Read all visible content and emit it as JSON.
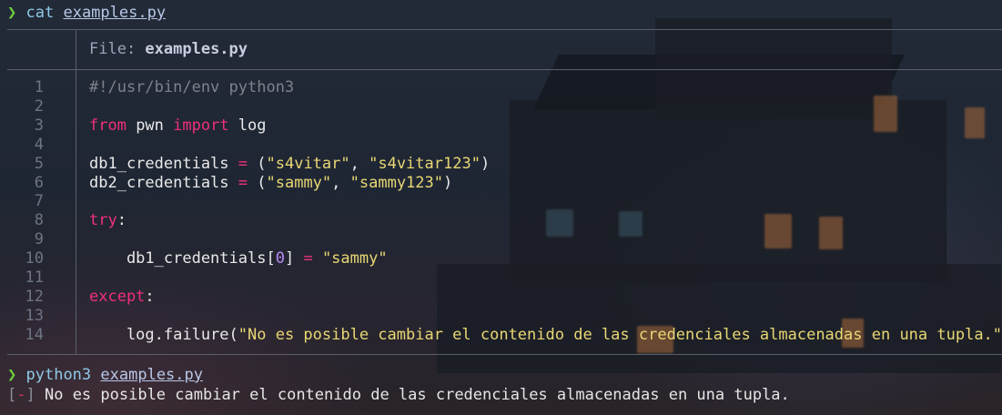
{
  "terminal": {
    "prompt_symbol": "❯",
    "first_command": {
      "cmd": "cat",
      "arg": "examples.py"
    },
    "bat": {
      "file_prefix": "File: ",
      "file_name": "examples.py",
      "lines": [
        {
          "n": "1",
          "tokens": [
            {
              "t": "#!/usr/bin/env python3",
              "c": "cmt"
            }
          ]
        },
        {
          "n": "2",
          "tokens": []
        },
        {
          "n": "3",
          "tokens": [
            {
              "t": "from",
              "c": "kw"
            },
            {
              "t": " pwn ",
              "c": ""
            },
            {
              "t": "import",
              "c": "kw"
            },
            {
              "t": " log",
              "c": ""
            }
          ]
        },
        {
          "n": "4",
          "tokens": []
        },
        {
          "n": "5",
          "tokens": [
            {
              "t": "db1_credentials ",
              "c": ""
            },
            {
              "t": "=",
              "c": "op"
            },
            {
              "t": " (",
              "c": ""
            },
            {
              "t": "\"s4vitar\"",
              "c": "str"
            },
            {
              "t": ", ",
              "c": ""
            },
            {
              "t": "\"s4vitar123\"",
              "c": "str"
            },
            {
              "t": ")",
              "c": ""
            }
          ]
        },
        {
          "n": "6",
          "tokens": [
            {
              "t": "db2_credentials ",
              "c": ""
            },
            {
              "t": "=",
              "c": "op"
            },
            {
              "t": " (",
              "c": ""
            },
            {
              "t": "\"sammy\"",
              "c": "str"
            },
            {
              "t": ", ",
              "c": ""
            },
            {
              "t": "\"sammy123\"",
              "c": "str"
            },
            {
              "t": ")",
              "c": ""
            }
          ]
        },
        {
          "n": "7",
          "tokens": []
        },
        {
          "n": "8",
          "tokens": [
            {
              "t": "try",
              "c": "kw"
            },
            {
              "t": ":",
              "c": ""
            }
          ]
        },
        {
          "n": "9",
          "tokens": []
        },
        {
          "n": "10",
          "tokens": [
            {
              "t": "    db1_credentials[",
              "c": ""
            },
            {
              "t": "0",
              "c": "num"
            },
            {
              "t": "] ",
              "c": ""
            },
            {
              "t": "=",
              "c": "op"
            },
            {
              "t": " ",
              "c": ""
            },
            {
              "t": "\"sammy\"",
              "c": "str"
            }
          ]
        },
        {
          "n": "11",
          "tokens": []
        },
        {
          "n": "12",
          "tokens": [
            {
              "t": "except",
              "c": "kw"
            },
            {
              "t": ":",
              "c": ""
            }
          ]
        },
        {
          "n": "13",
          "tokens": []
        },
        {
          "n": "14",
          "tokens": [
            {
              "t": "    log.failure(",
              "c": ""
            },
            {
              "t": "\"No es posible cambiar el contenido de las credenciales almacenadas en una tupla.\"",
              "c": "str"
            },
            {
              "t": ")",
              "c": ""
            }
          ]
        }
      ]
    },
    "second_command": {
      "cmd": "python3",
      "arg": "examples.py"
    },
    "output": {
      "bracket_open": "[",
      "marker": "-",
      "bracket_close": "]",
      "message": " No es posible cambiar el contenido de las credenciales almacenadas en una tupla."
    }
  }
}
